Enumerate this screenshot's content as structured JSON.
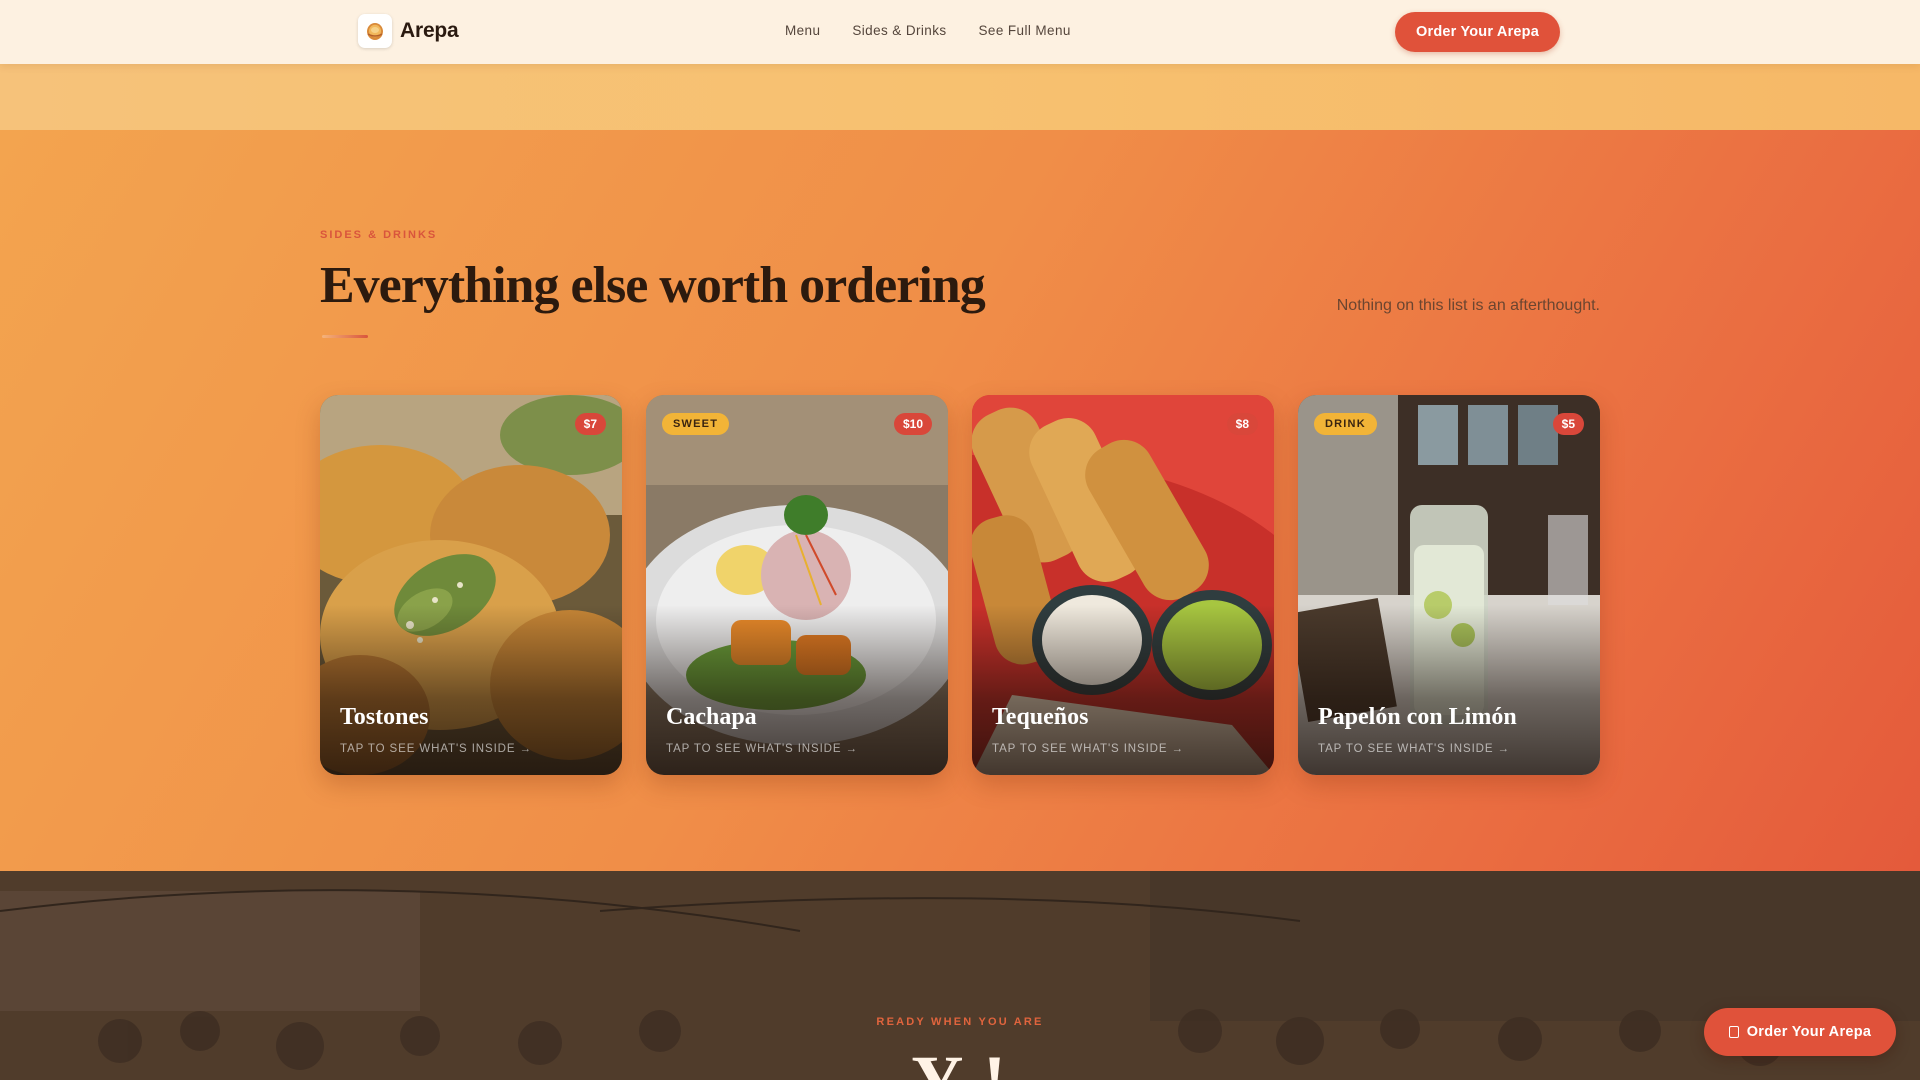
{
  "header": {
    "brand": "Arepa",
    "nav": [
      "Menu",
      "Sides & Drinks",
      "See Full Menu"
    ],
    "cta_label": "Order Your Arepa"
  },
  "section": {
    "eyebrow": "SIDES & DRINKS",
    "title": "Everything else worth ordering",
    "tagline": "Nothing on this list is an afterthought."
  },
  "cards": [
    {
      "name": "Tostones",
      "price": "$7",
      "tag": "",
      "hint": "TAP TO SEE WHAT'S INSIDE →"
    },
    {
      "name": "Cachapa",
      "price": "$10",
      "tag": "SWEET",
      "hint": "TAP TO SEE WHAT'S INSIDE →"
    },
    {
      "name": "Tequeños",
      "price": "$8",
      "tag": "",
      "hint": "TAP TO SEE WHAT'S INSIDE →"
    },
    {
      "name": "Papelón con Limón",
      "price": "$5",
      "tag": "DRINK",
      "hint": "TAP TO SEE WHAT'S INSIDE →"
    }
  ],
  "cta_section": {
    "eyebrow": "READY WHEN YOU ARE",
    "heading_partial": "Y  !"
  },
  "floating_cta": {
    "label": "Order Your Arepa"
  },
  "colors": {
    "accent": "#e0523a",
    "section_start": "#f3a44f",
    "section_end": "#e45a3b",
    "title": "#2c1a0e",
    "tag": "#f2b437",
    "price_badge": "#d9473a"
  },
  "icons": [
    "arepa-logo-icon",
    "bag-icon"
  ]
}
